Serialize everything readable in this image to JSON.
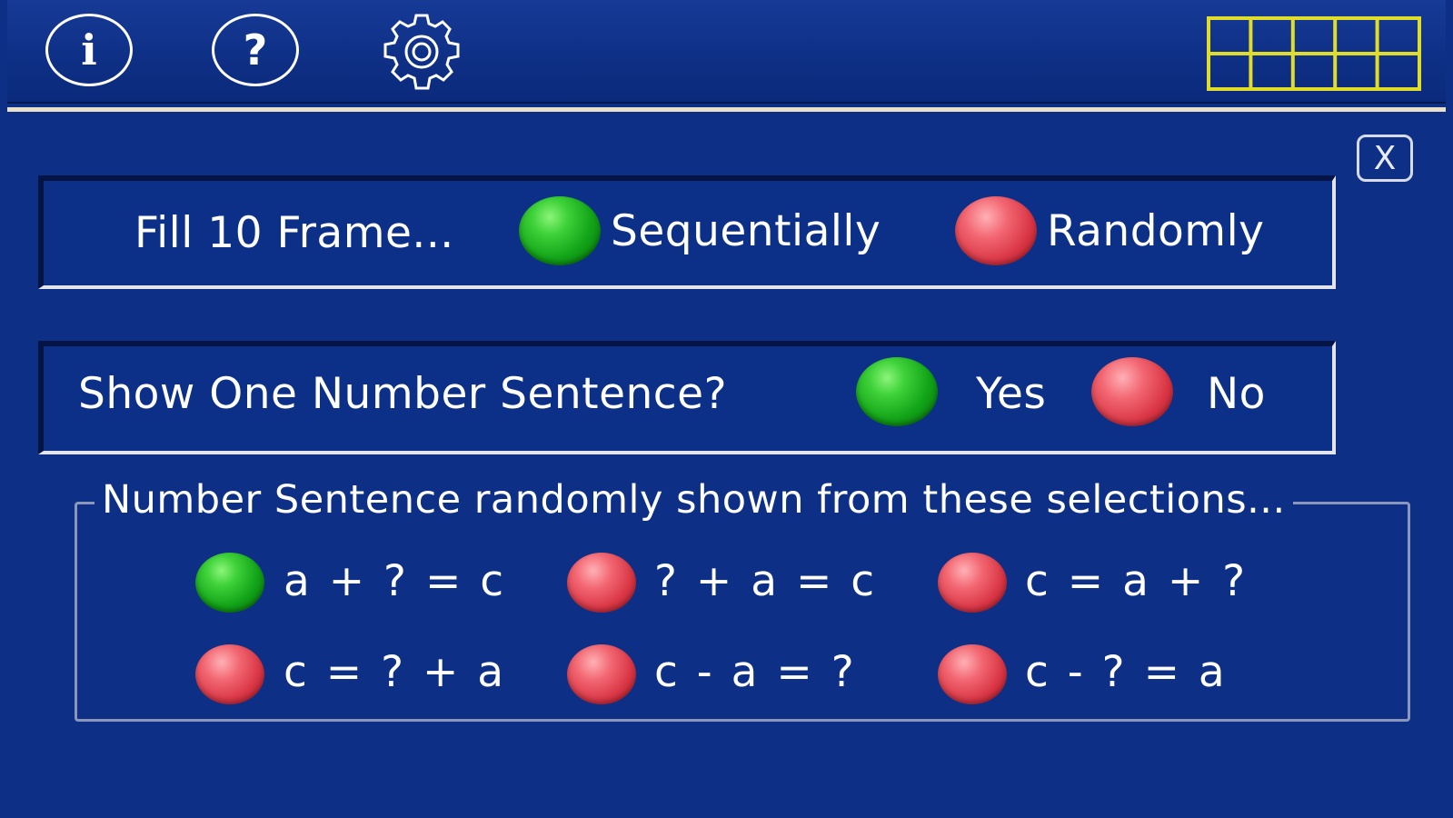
{
  "toolbar": {
    "info_label": "i",
    "help_label": "?",
    "close_label": "X"
  },
  "fill_frame": {
    "label": "Fill 10 Frame...",
    "options": [
      {
        "label": "Sequentially",
        "selected": true
      },
      {
        "label": "Randomly",
        "selected": false
      }
    ]
  },
  "show_sentence": {
    "label": "Show One Number Sentence?",
    "options": [
      {
        "label": "Yes",
        "selected": true
      },
      {
        "label": "No",
        "selected": false
      }
    ]
  },
  "sentences": {
    "title": "Number Sentence randomly shown from these selections...",
    "items": [
      {
        "label": "a + ? = c",
        "selected": true
      },
      {
        "label": "? + a = c",
        "selected": false
      },
      {
        "label": "c = a + ?",
        "selected": false
      },
      {
        "label": "c = ? + a",
        "selected": false
      },
      {
        "label": "c - a = ?",
        "selected": false
      },
      {
        "label": "c - ? = a",
        "selected": false
      }
    ]
  },
  "colors": {
    "background": "#0d2f86",
    "selected": "#2cc22c",
    "unselected": "#e04452",
    "ten_frame": "#e0dc2a"
  }
}
